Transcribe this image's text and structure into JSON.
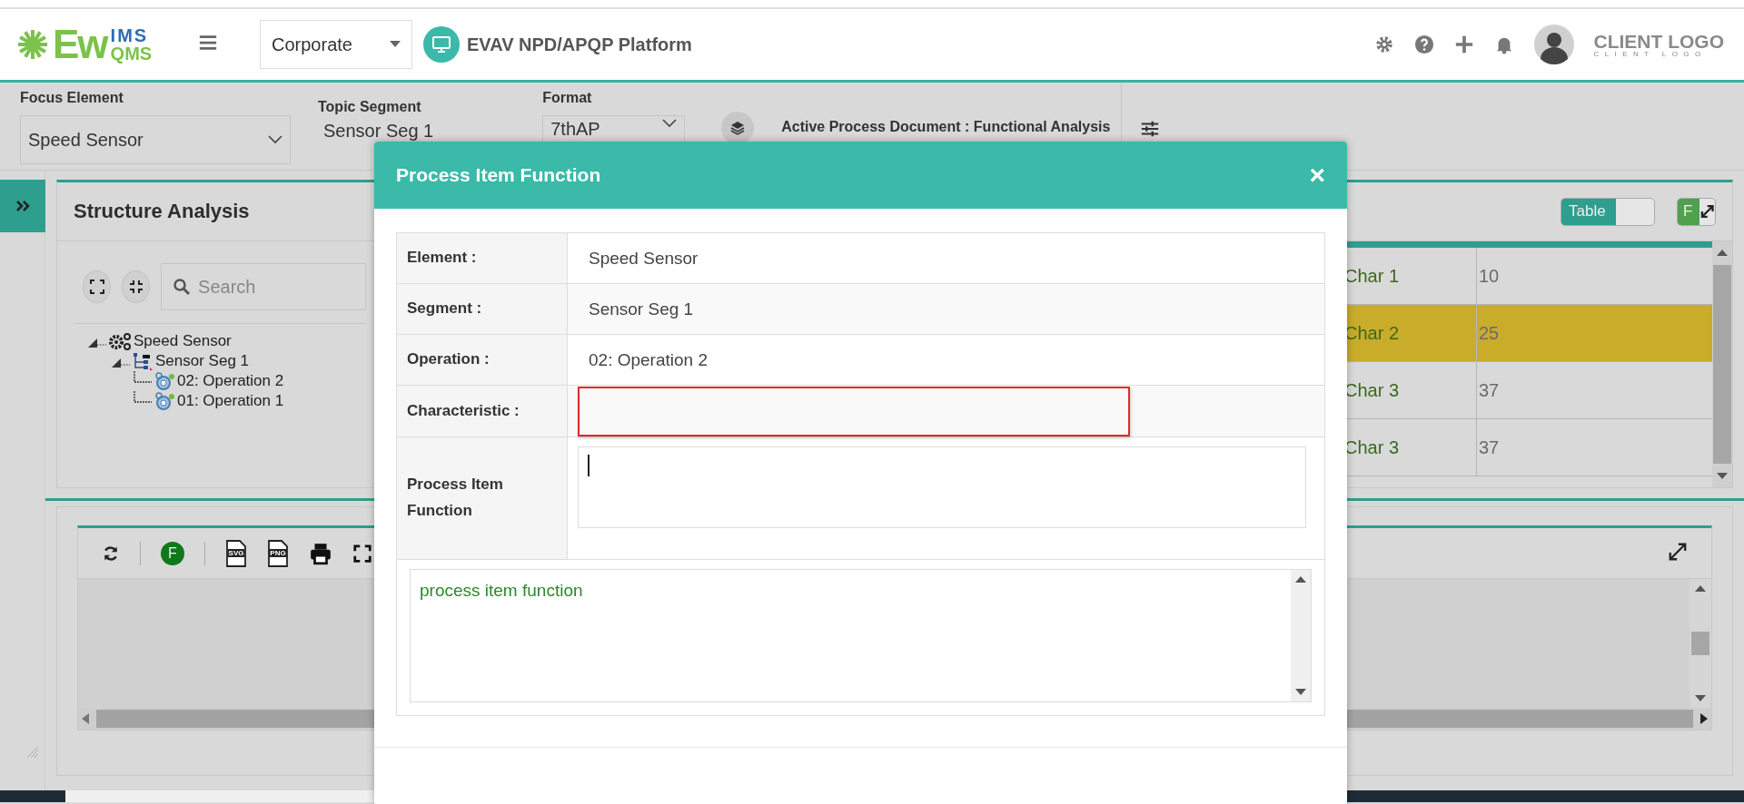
{
  "header": {
    "logo": {
      "main": "Ew",
      "sup": "IMS",
      "sub": "QMS"
    },
    "org_select": "Corporate",
    "platform": "EVAV NPD/APQP Platform",
    "client_logo": "CLIENT LOGO",
    "client_logo_sub": "CLIENT LOGO"
  },
  "filters": [
    {
      "label": "Focus Element",
      "value": "Speed Sensor",
      "kind": "select"
    },
    {
      "label": "Topic Segment",
      "value": "Sensor Seg 1",
      "kind": "text"
    },
    {
      "label": "Format",
      "value": "7thAP",
      "kind": "select"
    }
  ],
  "active_document": "Active Process Document : Functional Analysis",
  "structure_panel": {
    "title": "Structure Analysis",
    "search_placeholder": "Search",
    "view_toggle": "Table",
    "f_button": "F",
    "tree": [
      {
        "label": "Speed Sensor",
        "kind": "element",
        "expanded": true,
        "children": [
          {
            "label": "Sensor Seg 1",
            "kind": "segment",
            "expanded": true,
            "children": [
              {
                "label": "02: Operation 2",
                "kind": "operation"
              },
              {
                "label": "01: Operation 1",
                "kind": "operation"
              }
            ]
          }
        ]
      }
    ],
    "table_rows": [
      {
        "cells": [
          "Char 1",
          "10"
        ],
        "selected": false
      },
      {
        "cells": [
          "Char 2",
          "25"
        ],
        "selected": true
      },
      {
        "cells": [
          "Char 3",
          "37"
        ],
        "selected": false
      },
      {
        "cells": [
          "Char 3",
          "37"
        ],
        "selected": false
      }
    ]
  },
  "diagram_toolbar": [
    {
      "kind": "refresh"
    },
    {
      "kind": "divider"
    },
    {
      "kind": "f",
      "label": "F"
    },
    {
      "kind": "divider"
    },
    {
      "kind": "file",
      "label": "SVG"
    },
    {
      "kind": "file",
      "label": "PNG"
    },
    {
      "kind": "print"
    },
    {
      "kind": "fullscreen"
    }
  ],
  "modal": {
    "title": "Process Item Function",
    "close": "×",
    "fields": [
      {
        "label": "Element :",
        "value": "Speed Sensor",
        "kind": "static"
      },
      {
        "label": "Segment :",
        "value": "Sensor Seg 1",
        "kind": "static"
      },
      {
        "label": "Operation :",
        "value": "02: Operation 2",
        "kind": "static"
      },
      {
        "label": "Characteristic :",
        "kind": "select",
        "invalid": true
      },
      {
        "label": "Process Item Function",
        "kind": "textarea"
      }
    ],
    "suggestions": [
      "process item function"
    ]
  }
}
